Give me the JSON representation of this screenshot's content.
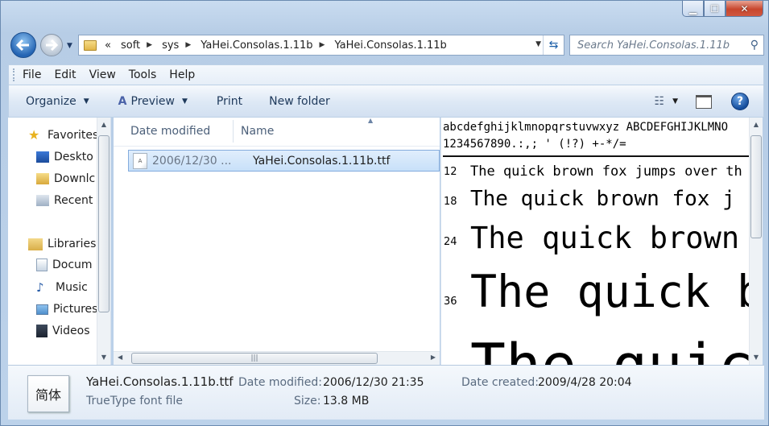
{
  "window": {
    "buttons": {
      "minimize": "minimize",
      "maximize": "maximize",
      "close": "close"
    }
  },
  "address": {
    "overflow": "«",
    "crumbs": [
      "soft",
      "sys",
      "YaHei.Consolas.1.11b",
      "YaHei.Consolas.1.11b"
    ]
  },
  "search": {
    "placeholder": "Search YaHei.Consolas.1.11b"
  },
  "menu": [
    "File",
    "Edit",
    "View",
    "Tools",
    "Help"
  ],
  "toolbar": {
    "organize": "Organize",
    "preview": "Preview",
    "print": "Print",
    "new_folder": "New folder"
  },
  "nav": {
    "favorites": "Favorites",
    "desktop": "Deskto",
    "downloads": "Downlc",
    "recent": "Recent",
    "libraries": "Libraries",
    "documents": "Docum",
    "music": "Music",
    "pictures": "Pictures",
    "videos": "Videos"
  },
  "columns": {
    "date_modified": "Date modified",
    "name": "Name"
  },
  "files": [
    {
      "date": "2006/12/30 ...",
      "name": "YaHei.Consolas.1.11b.ttf"
    }
  ],
  "preview": {
    "charset1": "abcdefghijklmnopqrstuvwxyz ABCDEFGHIJKLMNO",
    "charset2": "1234567890.:,; '  (!?) +-*/=",
    "samples": [
      {
        "size": "12",
        "text": "The quick brown fox jumps over th"
      },
      {
        "size": "18",
        "text": "The quick brown fox j"
      },
      {
        "size": "24",
        "text": "The quick brown f"
      },
      {
        "size": "36",
        "text": "The quick b"
      },
      {
        "size": "",
        "text": "The quic"
      }
    ]
  },
  "details": {
    "thumb_text": "简体",
    "filename": "YaHei.Consolas.1.11b.ttf",
    "type": "TrueType font file",
    "date_modified_label": "Date modified:",
    "date_modified": "2006/12/30 21:35",
    "date_created_label": "Date created:",
    "date_created": "2009/4/28 20:04",
    "size_label": "Size:",
    "size": "13.8 MB"
  }
}
